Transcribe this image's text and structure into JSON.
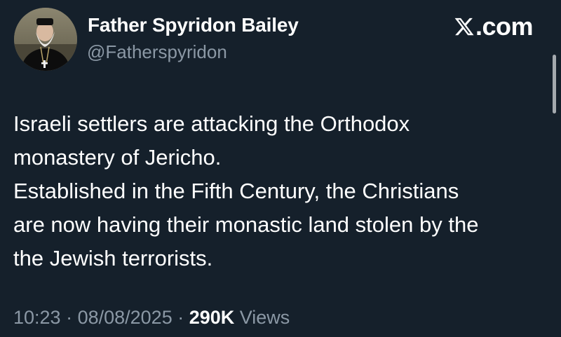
{
  "author": {
    "name": "Father Spyridon Bailey",
    "handle": "@Fatherspyridon"
  },
  "brand": {
    "label": ".com",
    "icon": "x-logo-icon"
  },
  "tweet": {
    "lines": [
      "Israeli settlers are attacking the Orthodox",
      "monastery of Jericho.",
      "Established in the Fifth Century, the Christians",
      "are now having their monastic land stolen by the",
      "the Jewish terrorists."
    ]
  },
  "meta": {
    "time": "10:23",
    "separator": " · ",
    "date": "08/08/2025",
    "views_count": "290K",
    "views_label": " Views"
  },
  "colors": {
    "background": "#15202b",
    "text": "#ffffff",
    "secondary_text": "#8b98a5"
  }
}
